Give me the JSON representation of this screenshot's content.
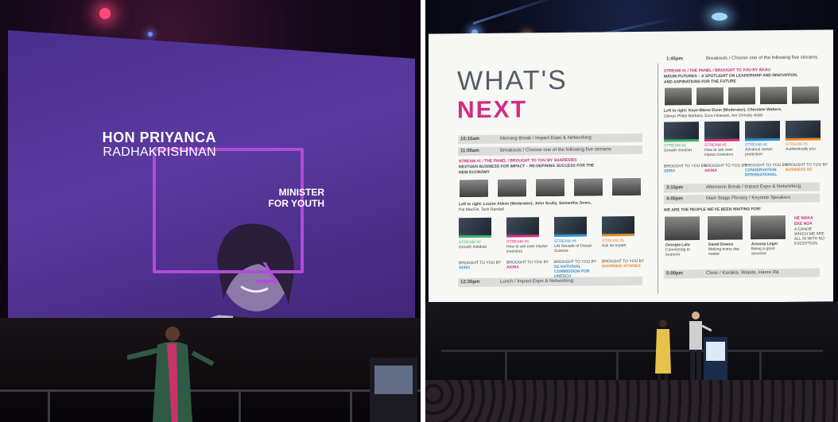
{
  "left_slide": {
    "name_line1": "HON PRIYANCA",
    "name_line2": "RADHAKRISHNAN",
    "title_line1": "MINISTER",
    "title_line2": "FOR YOUTH"
  },
  "right_slide": {
    "heading_line1": "WHAT'S",
    "heading_line2": "NEXT",
    "accent_color": "#d12d82",
    "left_column": {
      "row1_time": "10:15am",
      "row1_text": "Morning Break / Impact Expo & Networking",
      "row2_time": "11:00am",
      "row2_text": "Breakouts / Choose one of the following five streams",
      "stream1_line1": "STREAM #1 / THE PANEL / BROUGHT TO YOU BY SHARESIES",
      "stream1_line2": "NEXTGEN BUSINESS FOR IMPACT – RE-DEFINING SUCCESS FOR THE",
      "stream1_line3": "NEW ECONOMY",
      "panel_caption1": "Left to right: Louise Aitken (Moderator), John Scully, Samantha Jones,",
      "panel_caption2": "Pat MacFie, Tash Randall",
      "streams": [
        {
          "label": "STREAM #2",
          "desc": "Growth mindset",
          "sponsor_prefix": "BROUGHT TO YOU BY",
          "sponsor": "XERO"
        },
        {
          "label": "STREAM #3",
          "desc": "How to win over impact investors",
          "sponsor_prefix": "BROUGHT TO YOU BY",
          "sponsor": "AKINA"
        },
        {
          "label": "STREAM #4",
          "desc": "UN Decade of Ocean Science",
          "sponsor_prefix": "BROUGHT TO YOU BY",
          "sponsor": "NZ NATIONAL COMMISSION FOR UNESCO"
        },
        {
          "label": "STREAM #5",
          "desc": "Ask an expert",
          "sponsor_prefix": "BROUGHT TO YOU BY",
          "sponsor": "INSPIRING STORIES"
        }
      ],
      "row3_time": "12:30pm",
      "row3_text": "Lunch / Impact Expo & Networking"
    },
    "right_column": {
      "row1_time": "1:45pm",
      "row1_text": "Breakouts / Choose one of the following five streams",
      "stream1_line1": "STREAM #1 / THE PANEL / BROUGHT TO YOU BY ĀKAU",
      "stream1_line2": "MĀORI FUTURES – A SPOTLIGHT ON LEADERSHIP AND INNOVATION,",
      "stream1_line3": "AND ASPIRATIONS FOR THE FUTURE",
      "panel_caption1": "Left to right: Kaye-Maree Dunn (Moderator), Cherokee Walters,",
      "panel_caption2": "Glenys Philip-Barbara, Ezra Hirawani, Ani Ormsby-Addo",
      "streams": [
        {
          "label": "STREAM #2",
          "desc": "Growth mindset",
          "sponsor_prefix": "BROUGHT TO YOU BY",
          "sponsor": "XERO"
        },
        {
          "label": "STREAM #3",
          "desc": "How to win over impact investors",
          "sponsor_prefix": "BROUGHT TO YOU BY",
          "sponsor": "AKINA"
        },
        {
          "label": "STREAM #4",
          "desc": "Advance ocean protection",
          "sponsor_prefix": "BROUGHT TO YOU BY",
          "sponsor": "CONSERVATION INTERNATIONAL"
        },
        {
          "label": "STREAM #5",
          "desc": "Authentically you",
          "sponsor_prefix": "BROUGHT TO YOU BY",
          "sponsor": "BUSINESS NZ"
        }
      ],
      "row2_time": "3:15pm",
      "row2_text": "Afternoon Break / Impact Expo & Networking",
      "row3_time": "4:00pm",
      "row3_text": "Main Stage Plenary / Keynote Speakers",
      "plenary_title": "WE ARE THE PEOPLE WE'VE BEEN WAITING FOR!",
      "speakers": [
        {
          "name": "Georgia Latu",
          "desc": "Connecting to tuupuna"
        },
        {
          "name": "David Downs",
          "desc": "Making every day matter"
        },
        {
          "name": "Arizona Leger",
          "desc": "Being a good ancestor"
        }
      ],
      "whakatauki1": "HE WAKA",
      "whakatauki2": "EKE NOA",
      "whakatauki3": "A CANOE WHICH WE ARE ALL IN WITH NO EXCEPTION",
      "row4_time": "5:00pm",
      "row4_text": "Close / Karakia, Waiata, Haere Rā"
    }
  }
}
